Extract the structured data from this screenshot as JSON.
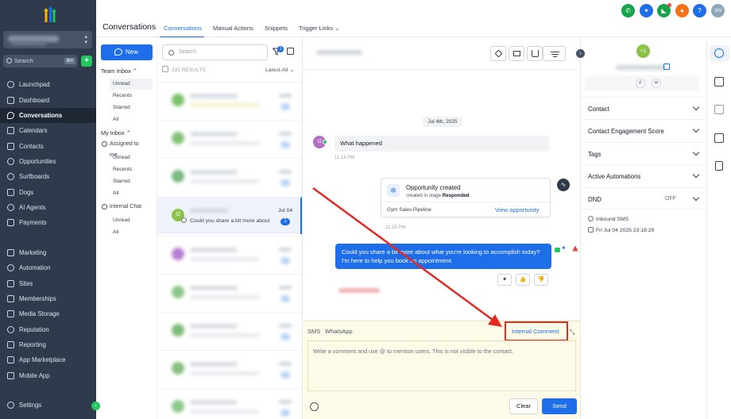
{
  "sidebar": {
    "search_label": "Search",
    "search_shortcut": "⌘K",
    "items": [
      {
        "label": "Launchpad",
        "icon": "rocket-icon"
      },
      {
        "label": "Dashboard",
        "icon": "dashboard-icon"
      },
      {
        "label": "Conversations",
        "icon": "chat-icon",
        "active": true
      },
      {
        "label": "Calendars",
        "icon": "calendar-icon"
      },
      {
        "label": "Contacts",
        "icon": "contacts-icon"
      },
      {
        "label": "Opportunities",
        "icon": "opportunities-icon"
      },
      {
        "label": "Surfboards",
        "icon": "surfboard-icon"
      },
      {
        "label": "Dogs",
        "icon": "dog-icon"
      },
      {
        "label": "AI Agents",
        "icon": "ai-icon"
      },
      {
        "label": "Payments",
        "icon": "payments-icon"
      },
      {
        "label": "Marketing",
        "icon": "marketing-icon"
      },
      {
        "label": "Automation",
        "icon": "automation-icon"
      },
      {
        "label": "Sites",
        "icon": "sites-icon"
      },
      {
        "label": "Memberships",
        "icon": "memberships-icon"
      },
      {
        "label": "Media Storage",
        "icon": "media-icon"
      },
      {
        "label": "Reputation",
        "icon": "star-icon"
      },
      {
        "label": "Reporting",
        "icon": "reporting-icon"
      },
      {
        "label": "App Marketplace",
        "icon": "marketplace-icon"
      },
      {
        "label": "Mobile App",
        "icon": "mobile-icon"
      }
    ],
    "settings_label": "Settings"
  },
  "header": {
    "title": "Conversations",
    "tabs": [
      {
        "label": "Conversations",
        "active": true
      },
      {
        "label": "Manual Actions"
      },
      {
        "label": "Snippets"
      },
      {
        "label": "Trigger Links ⌄"
      }
    ],
    "icons": [
      {
        "name": "phone-icon",
        "color": "#16a34a",
        "glyph": "✆"
      },
      {
        "name": "magic-icon",
        "color": "#1d6ee8",
        "glyph": "✦"
      },
      {
        "name": "megaphone-icon",
        "color": "#16a34a",
        "glyph": "◣",
        "badge": true
      },
      {
        "name": "bell-icon",
        "color": "#f97316",
        "glyph": "●"
      },
      {
        "name": "help-icon",
        "color": "#1d6ee8",
        "glyph": "?"
      },
      {
        "name": "user-avatar",
        "color": "#8fa6b8",
        "glyph": "SN"
      }
    ]
  },
  "folders": {
    "new_label": "New",
    "team_inbox": "Team Inbox",
    "team_items": [
      "Unread",
      "Recents",
      "Starred",
      "All"
    ],
    "my_inbox": "My Inbox",
    "assigned": "Assigned to me",
    "my_items": [
      "Unread",
      "Recents",
      "Starred",
      "All"
    ],
    "internal_chat": "Internal Chat",
    "internal_items": [
      "Unread",
      "All"
    ]
  },
  "list": {
    "search_placeholder": "Search",
    "filter_count": "1",
    "results_label": "332 RESULTS",
    "sort_label": "Latest-All ⌄",
    "active_conversation": {
      "initials": "I2",
      "date": "Jul 04",
      "preview": "Could you share a bit more about",
      "unread": "1"
    }
  },
  "chat": {
    "date_divider": "Jul 4th, 2025",
    "inbound": {
      "initials": "I2",
      "text": "What happened",
      "time": "11:18 PM"
    },
    "opportunity": {
      "title": "Opportunity created",
      "subtitle_prefix": "created in stage",
      "stage": "Responded",
      "pipeline": "Gym Sales Pipeline",
      "link": "View opportunity",
      "time": "11:18 PM"
    },
    "outbound": {
      "text": "Could you share a bit more about what you're looking to accomplish today? I'm here to help you book an appointment."
    },
    "composer": {
      "tabs": [
        "SMS",
        "WhatsApp",
        "Internal Comment"
      ],
      "placeholder": "Write a comment and use @ to mention users. This is not visible to the contact.",
      "clear_label": "Clear",
      "send_label": "Send"
    },
    "annotation_color": "#e32a23"
  },
  "contact": {
    "avatar": "+1",
    "sections": [
      {
        "label": "Contact",
        "value": ""
      },
      {
        "label": "Contact Engagement Score",
        "value": ""
      },
      {
        "label": "Tags",
        "value": ""
      },
      {
        "label": "Active Automations",
        "value": ""
      },
      {
        "label": "DND",
        "value": "OFF"
      }
    ],
    "inbound_label": "Inbound SMS",
    "inbound_time": "Fri Jul 04 2025 23:18:29"
  },
  "colors": {
    "accent": "#1d6ee8",
    "nav_bg": "#2f3b4c",
    "composer_bg": "#fdfbe8"
  }
}
